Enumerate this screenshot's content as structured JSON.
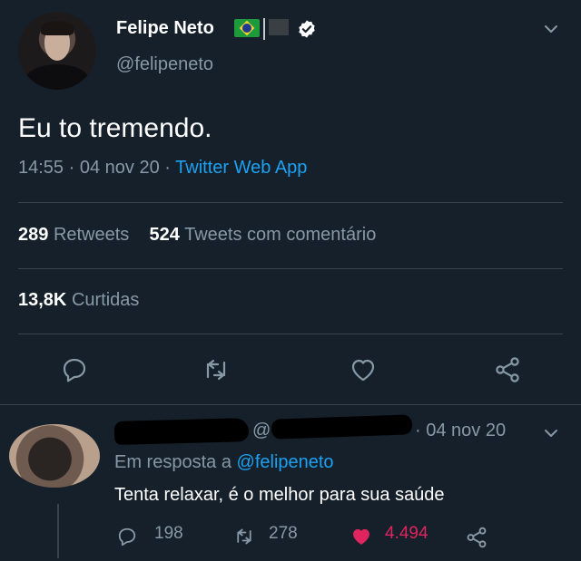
{
  "tweet": {
    "author_name": "Felipe Neto",
    "handle": "@felipeneto",
    "text": "Eu to tremendo.",
    "time": "14:55",
    "sep1": "·",
    "date": "04 nov 20",
    "sep2": "·",
    "source": "Twitter Web App",
    "retweets_count": "289",
    "retweets_label": "Retweets",
    "quotes_count": "524",
    "quotes_label": "Tweets com comentário",
    "likes_count": "13,8K",
    "likes_label": "Curtidas"
  },
  "reply": {
    "handle_prefix": "@",
    "date": "· 04 nov 20",
    "in_reply_to_label": "Em resposta a",
    "in_reply_to_handle": "@felipeneto",
    "text": "Tenta relaxar, é o melhor para sua saúde",
    "reply_count": "198",
    "retweet_count": "278",
    "like_count": "4.494"
  },
  "colors": {
    "background": "#15202b",
    "accent": "#1da1f2",
    "muted": "#8899a6",
    "like": "#e0245e"
  },
  "icons": [
    "verified-icon",
    "chevron-down-icon",
    "reply-icon",
    "retweet-icon",
    "like-icon",
    "share-icon"
  ]
}
